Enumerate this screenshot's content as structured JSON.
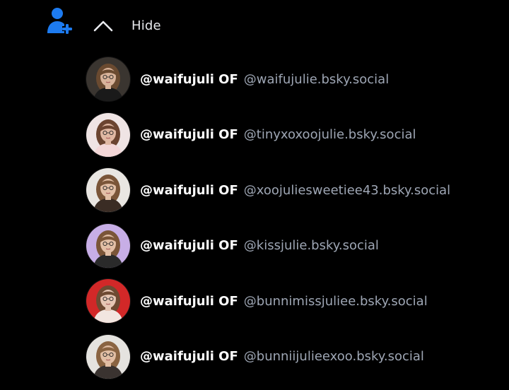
{
  "header": {
    "add_user_icon": "add-user-icon",
    "toggle_icon": "chevron-up-icon",
    "toggle_label": "Hide",
    "accent_color": "#1d7bf0"
  },
  "accounts": [
    {
      "display_name": "@waifujuli OF",
      "handle": "@waifujulie.bsky.social",
      "avatar_colors": {
        "bg": "#3a3530",
        "hair": "#6a4a30",
        "skin": "#d8b39a",
        "top": "#1a1a1a"
      }
    },
    {
      "display_name": "@waifujuli OF",
      "handle": "@tinyxoxoojulie.bsky.social",
      "avatar_colors": {
        "bg": "#efe4e4",
        "hair": "#6b4430",
        "skin": "#e0b8a3",
        "top": "#f3d7d8"
      }
    },
    {
      "display_name": "@waifujuli OF",
      "handle": "@xoojuliesweetiee43.bsky.social",
      "avatar_colors": {
        "bg": "#e9e6e2",
        "hair": "#7a5538",
        "skin": "#e2bfa6",
        "top": "#3a2c24"
      }
    },
    {
      "display_name": "@waifujuli OF",
      "handle": "@kissjulie.bsky.social",
      "avatar_colors": {
        "bg": "#c7aee6",
        "hair": "#7a5538",
        "skin": "#e2bfa6",
        "top": "#2a2a2a"
      }
    },
    {
      "display_name": "@waifujuli OF",
      "handle": "@bunnimissjuliee.bsky.social",
      "avatar_colors": {
        "bg": "#d22828",
        "hair": "#6e4a32",
        "skin": "#e6c6b4",
        "top": "#f2e6e0"
      }
    },
    {
      "display_name": "@waifujuli OF",
      "handle": "@bunniijulieexoo.bsky.social",
      "avatar_colors": {
        "bg": "#e5e3df",
        "hair": "#8a6442",
        "skin": "#e1bea4",
        "top": "#3a3330"
      }
    }
  ]
}
